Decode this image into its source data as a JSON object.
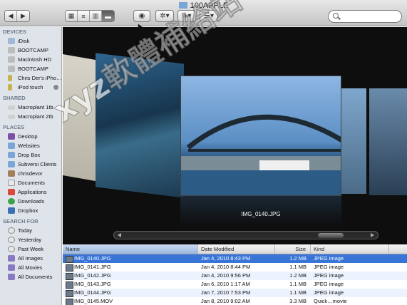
{
  "window": {
    "title": "100APPLE"
  },
  "toolbar": {
    "back_icon": "chevron-left",
    "forward_icon": "chevron-right",
    "view_modes": [
      "icon-view",
      "list-view",
      "column-view",
      "coverflow-view"
    ],
    "active_view": "coverflow-view",
    "quicklook_icon": "eye",
    "action_icon": "gear",
    "share_icon": "dropbox",
    "arrange_icon": "arrange"
  },
  "sidebar": {
    "devices_header": "DEVICES",
    "devices": [
      "iDisk",
      "BOOTCAMP",
      "Macintosh HD",
      "BOOTCAMP",
      "Chris Der's iPho…",
      "iPod touch"
    ],
    "shared_header": "SHARED",
    "shared": [
      "Macroplant 1tb",
      "Macroplant 2tb"
    ],
    "places_header": "PLACES",
    "places": [
      "Desktop",
      "Websites",
      "Drop Box",
      "Subversi Clients",
      "chrisdevor",
      "Documents",
      "Applications",
      "Downloads",
      "Dropbox"
    ],
    "search_header": "SEARCH FOR",
    "search": [
      "Today",
      "Yesterday",
      "Past Week",
      "All Images",
      "All Movies",
      "All Documents"
    ]
  },
  "coverflow": {
    "caption": "IMG_0140.JPG"
  },
  "list": {
    "columns": [
      "Name",
      "Date Modified",
      "Size",
      "Kind"
    ],
    "rows": [
      {
        "name": "IMG_0140.JPG",
        "date": "Jan 4, 2010 8:43 PM",
        "size": "1.2 MB",
        "kind": "JPEG image"
      },
      {
        "name": "IMG_0141.JPG",
        "date": "Jan 4, 2010 8:44 PM",
        "size": "1.1 MB",
        "kind": "JPEG image"
      },
      {
        "name": "IMG_0142.JPG",
        "date": "Jan 4, 2010 9:56 PM",
        "size": "1.2 MB",
        "kind": "JPEG image"
      },
      {
        "name": "IMG_0143.JPG",
        "date": "Jan 6, 2010 1:17 AM",
        "size": "1.1 MB",
        "kind": "JPEG image"
      },
      {
        "name": "IMG_0144.JPG",
        "date": "Jan 7, 2010 7:53 PM",
        "size": "1.1 MB",
        "kind": "JPEG image"
      },
      {
        "name": "IMG_0145.MOV",
        "date": "Jan 8, 2010 9:02 AM",
        "size": "3.3 MB",
        "kind": "Quick…movie"
      }
    ]
  },
  "overlay": {
    "watermark": "xyz軟體補給站 http://31.to"
  },
  "colors": {
    "selection": "#3875d7",
    "sidebar_bg": "#dfe4ea"
  }
}
